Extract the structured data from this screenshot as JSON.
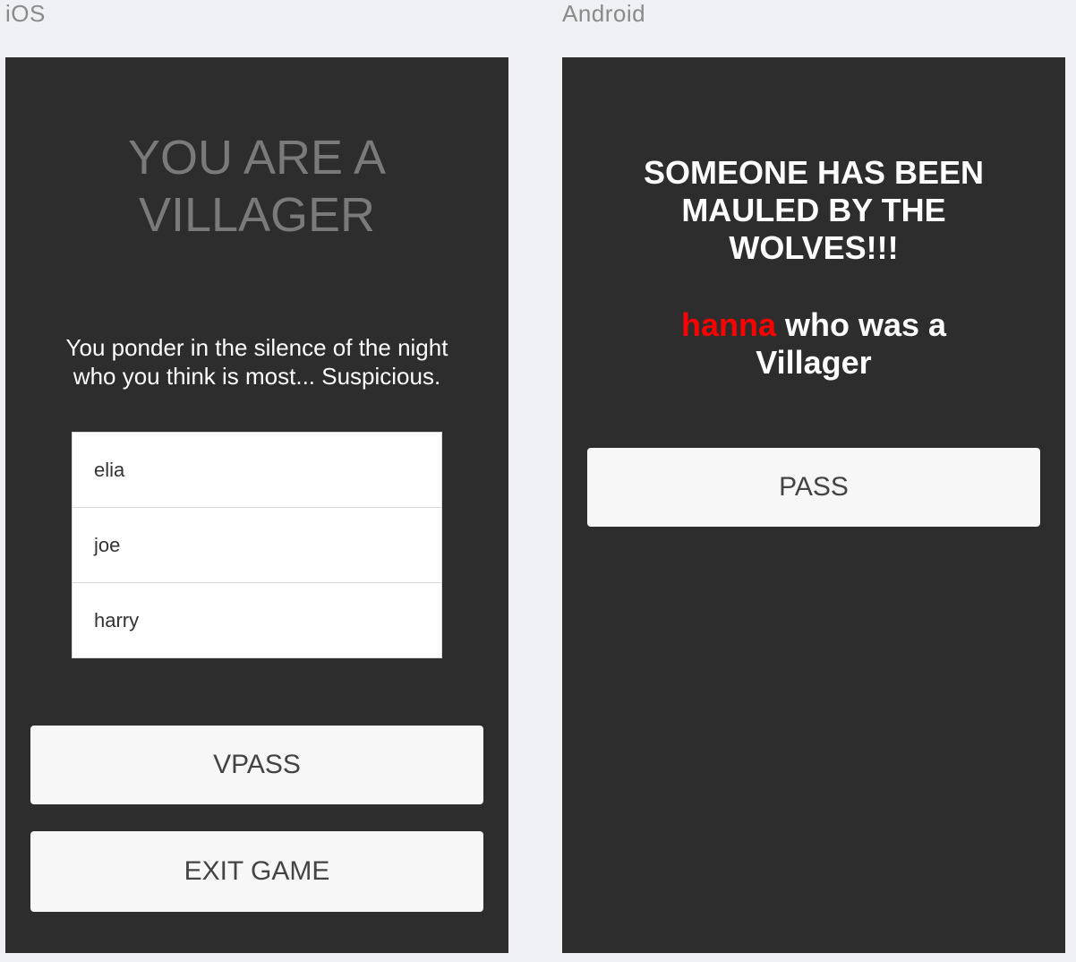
{
  "labels": {
    "ios": "iOS",
    "android": "Android"
  },
  "ios_screen": {
    "role_line1": "YOU ARE A",
    "role_line2": "VILLAGER",
    "ponder_text": "You ponder in the silence of the night who you think is most... Suspicious.",
    "players": [
      "elia",
      "joe",
      "harry"
    ],
    "vpass_label": "VPASS",
    "exit_label": "EXIT GAME"
  },
  "android_screen": {
    "mauled_title": "SOMEONE HAS BEEN MAULED BY THE WOLVES!!!",
    "victim_name": "hanna",
    "victim_role_line1": " who was a",
    "victim_role_line2": "Villager",
    "pass_label": "PASS"
  },
  "colors": {
    "page_background": "#eff0f4",
    "screen_background": "#2d2d2d",
    "role_title": "#7a7a7a",
    "victim_name": "#ff0000",
    "button_background": "#f7f7f7"
  }
}
